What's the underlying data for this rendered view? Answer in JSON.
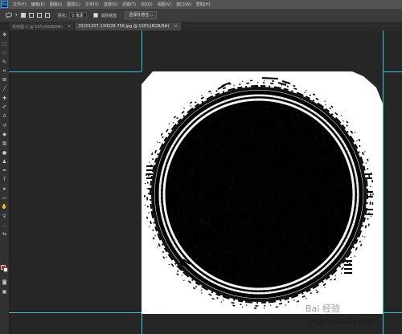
{
  "menubar": {
    "logo": "Ps",
    "items": [
      "文件(F)",
      "编辑(E)",
      "图像(I)",
      "图层(L)",
      "文字(Y)",
      "选择(S)",
      "滤镜(T)",
      "3D(D)",
      "视图(V)",
      "窗口(W)",
      "帮助(H)"
    ]
  },
  "options": {
    "tool_icon": "lasso-icon",
    "feather_label": "羽化:",
    "feather_value": "0 像素",
    "antialias_label": "消除锯齿",
    "select_mask_label": "选择并遮住..."
  },
  "tabs": [
    {
      "label": "未标题-1 @ 50%(RGB/8#)",
      "active": false
    },
    {
      "label": "20201207-130028-756.jpg @ 100%(RGB/8#)",
      "active": true
    }
  ],
  "watermark": {
    "text": "Bai 经验",
    "url": "jingyan.baidu.com"
  },
  "colors": {
    "foreground": "#e21010",
    "background": "#ffffff",
    "guide": "#36c8e0"
  }
}
